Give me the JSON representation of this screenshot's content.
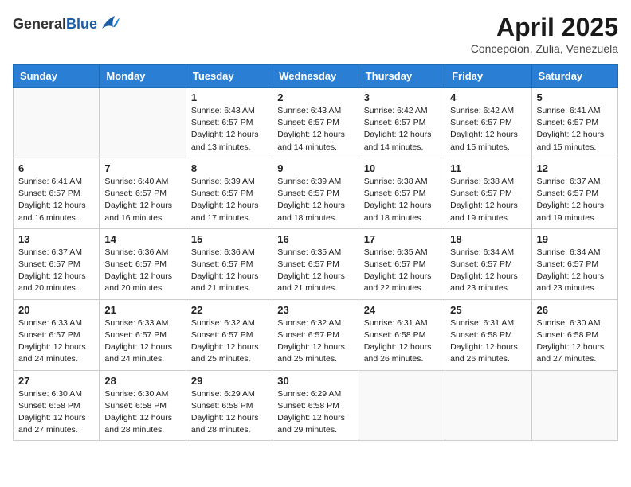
{
  "header": {
    "logo_general": "General",
    "logo_blue": "Blue",
    "month_year": "April 2025",
    "location": "Concepcion, Zulia, Venezuela"
  },
  "days_of_week": [
    "Sunday",
    "Monday",
    "Tuesday",
    "Wednesday",
    "Thursday",
    "Friday",
    "Saturday"
  ],
  "weeks": [
    [
      {
        "day": "",
        "info": ""
      },
      {
        "day": "",
        "info": ""
      },
      {
        "day": "1",
        "sunrise": "6:43 AM",
        "sunset": "6:57 PM",
        "daylight": "12 hours and 13 minutes."
      },
      {
        "day": "2",
        "sunrise": "6:43 AM",
        "sunset": "6:57 PM",
        "daylight": "12 hours and 14 minutes."
      },
      {
        "day": "3",
        "sunrise": "6:42 AM",
        "sunset": "6:57 PM",
        "daylight": "12 hours and 14 minutes."
      },
      {
        "day": "4",
        "sunrise": "6:42 AM",
        "sunset": "6:57 PM",
        "daylight": "12 hours and 15 minutes."
      },
      {
        "day": "5",
        "sunrise": "6:41 AM",
        "sunset": "6:57 PM",
        "daylight": "12 hours and 15 minutes."
      }
    ],
    [
      {
        "day": "6",
        "sunrise": "6:41 AM",
        "sunset": "6:57 PM",
        "daylight": "12 hours and 16 minutes."
      },
      {
        "day": "7",
        "sunrise": "6:40 AM",
        "sunset": "6:57 PM",
        "daylight": "12 hours and 16 minutes."
      },
      {
        "day": "8",
        "sunrise": "6:39 AM",
        "sunset": "6:57 PM",
        "daylight": "12 hours and 17 minutes."
      },
      {
        "day": "9",
        "sunrise": "6:39 AM",
        "sunset": "6:57 PM",
        "daylight": "12 hours and 18 minutes."
      },
      {
        "day": "10",
        "sunrise": "6:38 AM",
        "sunset": "6:57 PM",
        "daylight": "12 hours and 18 minutes."
      },
      {
        "day": "11",
        "sunrise": "6:38 AM",
        "sunset": "6:57 PM",
        "daylight": "12 hours and 19 minutes."
      },
      {
        "day": "12",
        "sunrise": "6:37 AM",
        "sunset": "6:57 PM",
        "daylight": "12 hours and 19 minutes."
      }
    ],
    [
      {
        "day": "13",
        "sunrise": "6:37 AM",
        "sunset": "6:57 PM",
        "daylight": "12 hours and 20 minutes."
      },
      {
        "day": "14",
        "sunrise": "6:36 AM",
        "sunset": "6:57 PM",
        "daylight": "12 hours and 20 minutes."
      },
      {
        "day": "15",
        "sunrise": "6:36 AM",
        "sunset": "6:57 PM",
        "daylight": "12 hours and 21 minutes."
      },
      {
        "day": "16",
        "sunrise": "6:35 AM",
        "sunset": "6:57 PM",
        "daylight": "12 hours and 21 minutes."
      },
      {
        "day": "17",
        "sunrise": "6:35 AM",
        "sunset": "6:57 PM",
        "daylight": "12 hours and 22 minutes."
      },
      {
        "day": "18",
        "sunrise": "6:34 AM",
        "sunset": "6:57 PM",
        "daylight": "12 hours and 23 minutes."
      },
      {
        "day": "19",
        "sunrise": "6:34 AM",
        "sunset": "6:57 PM",
        "daylight": "12 hours and 23 minutes."
      }
    ],
    [
      {
        "day": "20",
        "sunrise": "6:33 AM",
        "sunset": "6:57 PM",
        "daylight": "12 hours and 24 minutes."
      },
      {
        "day": "21",
        "sunrise": "6:33 AM",
        "sunset": "6:57 PM",
        "daylight": "12 hours and 24 minutes."
      },
      {
        "day": "22",
        "sunrise": "6:32 AM",
        "sunset": "6:57 PM",
        "daylight": "12 hours and 25 minutes."
      },
      {
        "day": "23",
        "sunrise": "6:32 AM",
        "sunset": "6:57 PM",
        "daylight": "12 hours and 25 minutes."
      },
      {
        "day": "24",
        "sunrise": "6:31 AM",
        "sunset": "6:58 PM",
        "daylight": "12 hours and 26 minutes."
      },
      {
        "day": "25",
        "sunrise": "6:31 AM",
        "sunset": "6:58 PM",
        "daylight": "12 hours and 26 minutes."
      },
      {
        "day": "26",
        "sunrise": "6:30 AM",
        "sunset": "6:58 PM",
        "daylight": "12 hours and 27 minutes."
      }
    ],
    [
      {
        "day": "27",
        "sunrise": "6:30 AM",
        "sunset": "6:58 PM",
        "daylight": "12 hours and 27 minutes."
      },
      {
        "day": "28",
        "sunrise": "6:30 AM",
        "sunset": "6:58 PM",
        "daylight": "12 hours and 28 minutes."
      },
      {
        "day": "29",
        "sunrise": "6:29 AM",
        "sunset": "6:58 PM",
        "daylight": "12 hours and 28 minutes."
      },
      {
        "day": "30",
        "sunrise": "6:29 AM",
        "sunset": "6:58 PM",
        "daylight": "12 hours and 29 minutes."
      },
      {
        "day": "",
        "info": ""
      },
      {
        "day": "",
        "info": ""
      },
      {
        "day": "",
        "info": ""
      }
    ]
  ]
}
